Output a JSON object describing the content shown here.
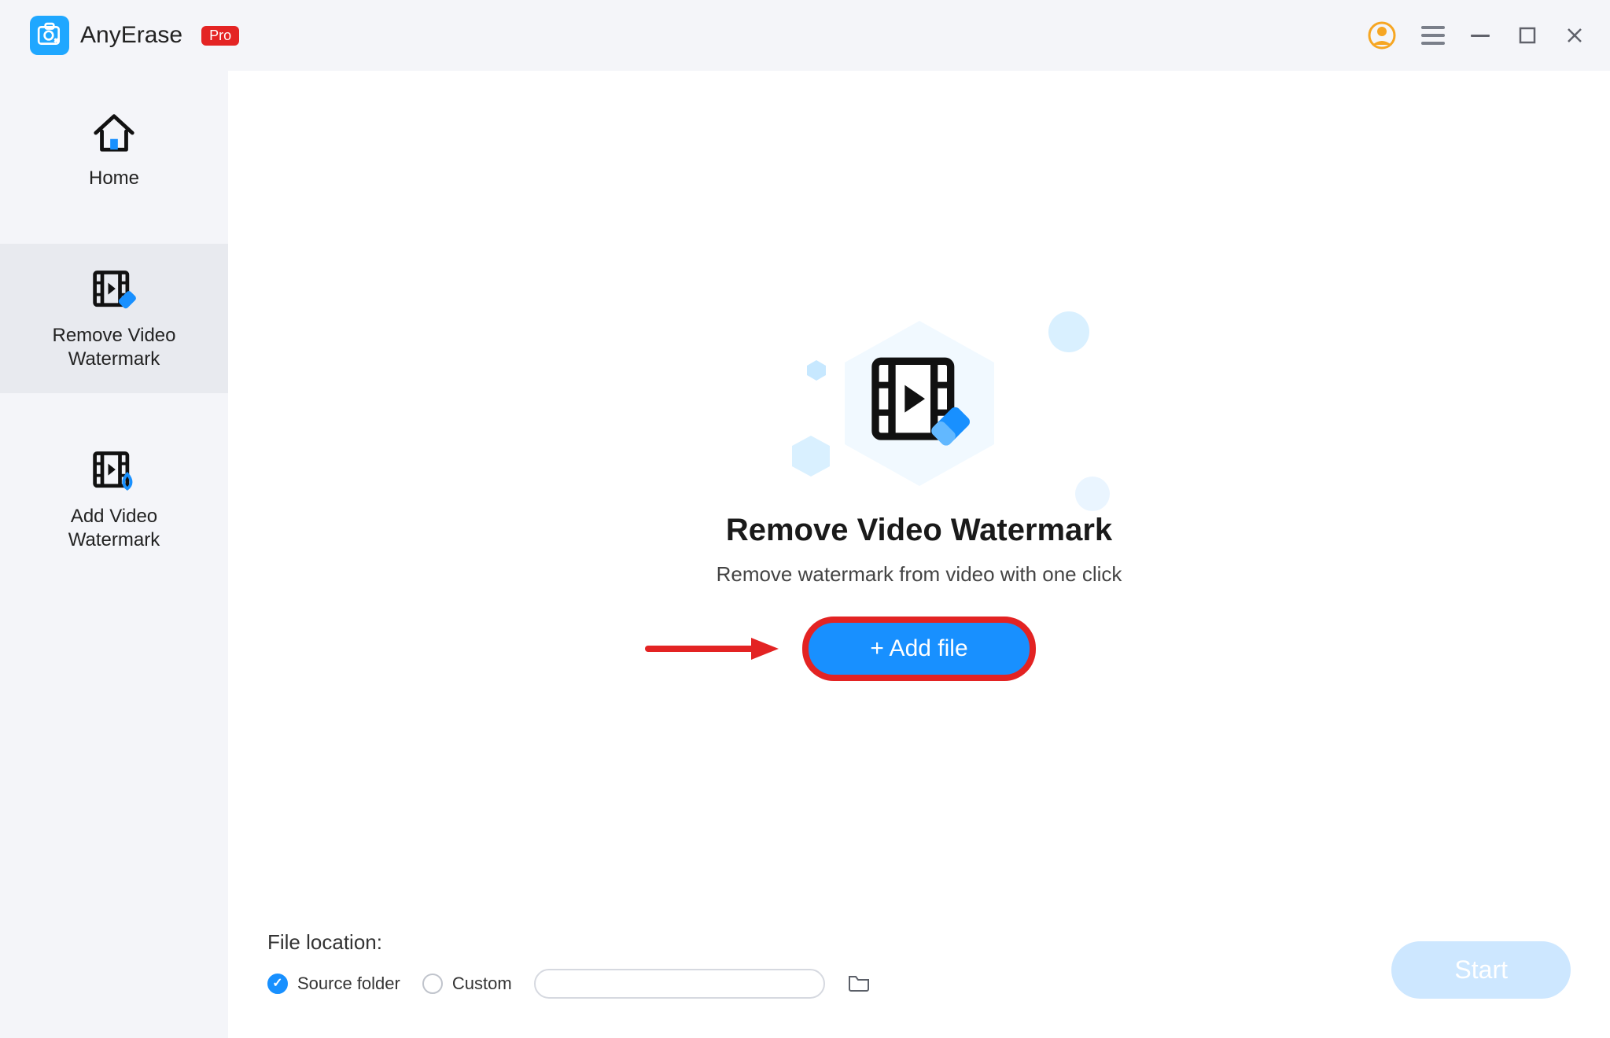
{
  "titlebar": {
    "app_name": "AnyErase",
    "pro_badge": "Pro"
  },
  "sidebar": {
    "items": [
      {
        "label": "Home"
      },
      {
        "label": "Remove Video\nWatermark"
      },
      {
        "label": "Add Video\nWatermark"
      }
    ]
  },
  "hero": {
    "title": "Remove Video Watermark",
    "subtitle": "Remove watermark from video with one click",
    "add_file_label": "+ Add file"
  },
  "footer": {
    "file_location_label": "File location:",
    "source_label": "Source folder",
    "custom_label": "Custom",
    "start_label": "Start"
  }
}
